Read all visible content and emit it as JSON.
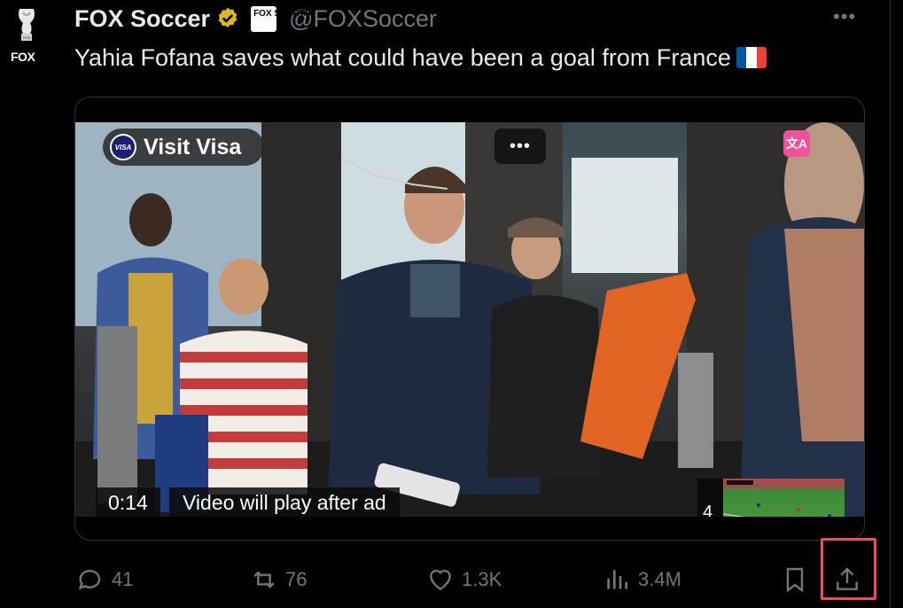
{
  "account": {
    "avatar_label": "FOX",
    "name": "FOX Soccer",
    "affiliate_label": "FOX SPORTS",
    "handle": "@FOXSoccer"
  },
  "tweet": {
    "text": "Yahia Fofana saves what could have been a goal from France",
    "flag_colors": [
      "#0055A4",
      "#FFFFFF",
      "#EF4135"
    ]
  },
  "video": {
    "sponsor_label": "Visit Visa",
    "sponsor_logo_text": "VISA",
    "time": "0:14",
    "ad_notice": "Video will play after ad",
    "up_next_count": "4"
  },
  "actions": {
    "replies": "41",
    "reposts": "76",
    "likes": "1.3K",
    "views": "3.4M"
  },
  "colors": {
    "verified_gold": "#e2b719",
    "highlight_red": "#ee4d55",
    "translate_pink": "#f2509b"
  }
}
